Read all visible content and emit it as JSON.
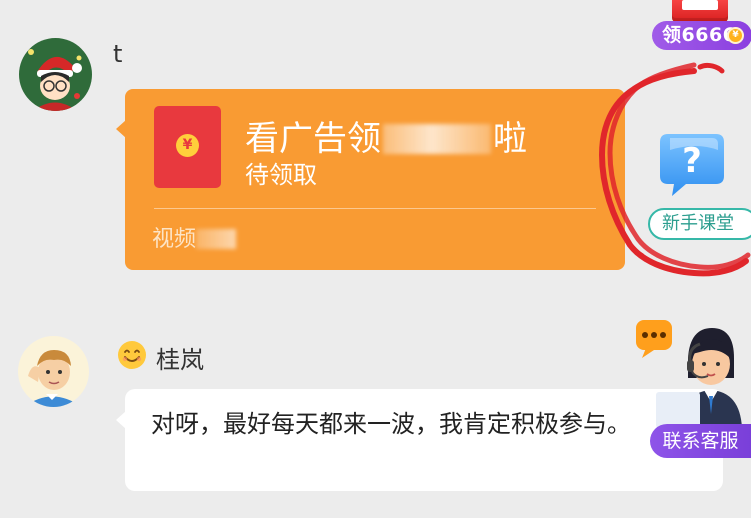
{
  "reward_badge": {
    "label": "领6666",
    "coin_icon": "coin-icon"
  },
  "messages": [
    {
      "sender": "t",
      "avatar": "christmas-cartoon-avatar",
      "packet": {
        "title_prefix": "看广告领",
        "title_suffix": "啦",
        "status": "待领取",
        "footer": "视频",
        "icon": "red-packet-icon"
      }
    },
    {
      "sender_emoji": "😊",
      "sender": "桂岚",
      "avatar": "cartoon-man-avatar",
      "text": "对呀，最好每天都来一波，我肯定积极参与。"
    }
  ],
  "help_button": {
    "label": "新手课堂",
    "icon": "question-bubble-icon"
  },
  "customer_service": {
    "label": "联系客服",
    "icon": "customer-service-agent-icon"
  },
  "colors": {
    "background": "#ececec",
    "packet_orange": "#f99b33",
    "packet_red": "#e8393e",
    "badge_purple": "#8b3fe0",
    "help_teal": "#36b8a8",
    "scribble_red": "#e0262b"
  }
}
